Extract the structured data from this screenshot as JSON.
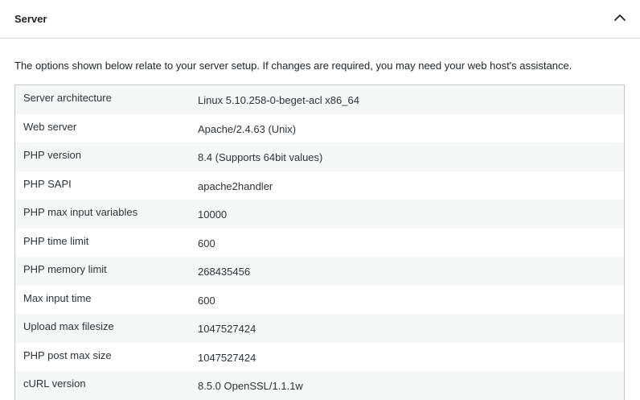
{
  "section": {
    "title": "Server",
    "toggle_icon": "chevron-up-icon"
  },
  "description": "The options shown below relate to your server setup. If changes are required, you may need your web host's assistance.",
  "rows": [
    {
      "label": "Server architecture",
      "value": "Linux 5.10.258-0-beget-acl x86_64"
    },
    {
      "label": "Web server",
      "value": "Apache/2.4.63 (Unix)"
    },
    {
      "label": "PHP version",
      "value": "8.4 (Supports 64bit values)"
    },
    {
      "label": "PHP SAPI",
      "value": "apache2handler"
    },
    {
      "label": "PHP max input variables",
      "value": "10000"
    },
    {
      "label": "PHP time limit",
      "value": "600"
    },
    {
      "label": "PHP memory limit",
      "value": "268435456"
    },
    {
      "label": "Max input time",
      "value": "600"
    },
    {
      "label": "Upload max filesize",
      "value": "1047527424"
    },
    {
      "label": "PHP post max size",
      "value": "1047527424"
    },
    {
      "label": "cURL version",
      "value": "8.5.0 OpenSSL/1.1.1w"
    }
  ],
  "colors": {
    "text": "#1d2327",
    "row_alt": "#f6f7f7",
    "border": "#c3c4c7"
  }
}
